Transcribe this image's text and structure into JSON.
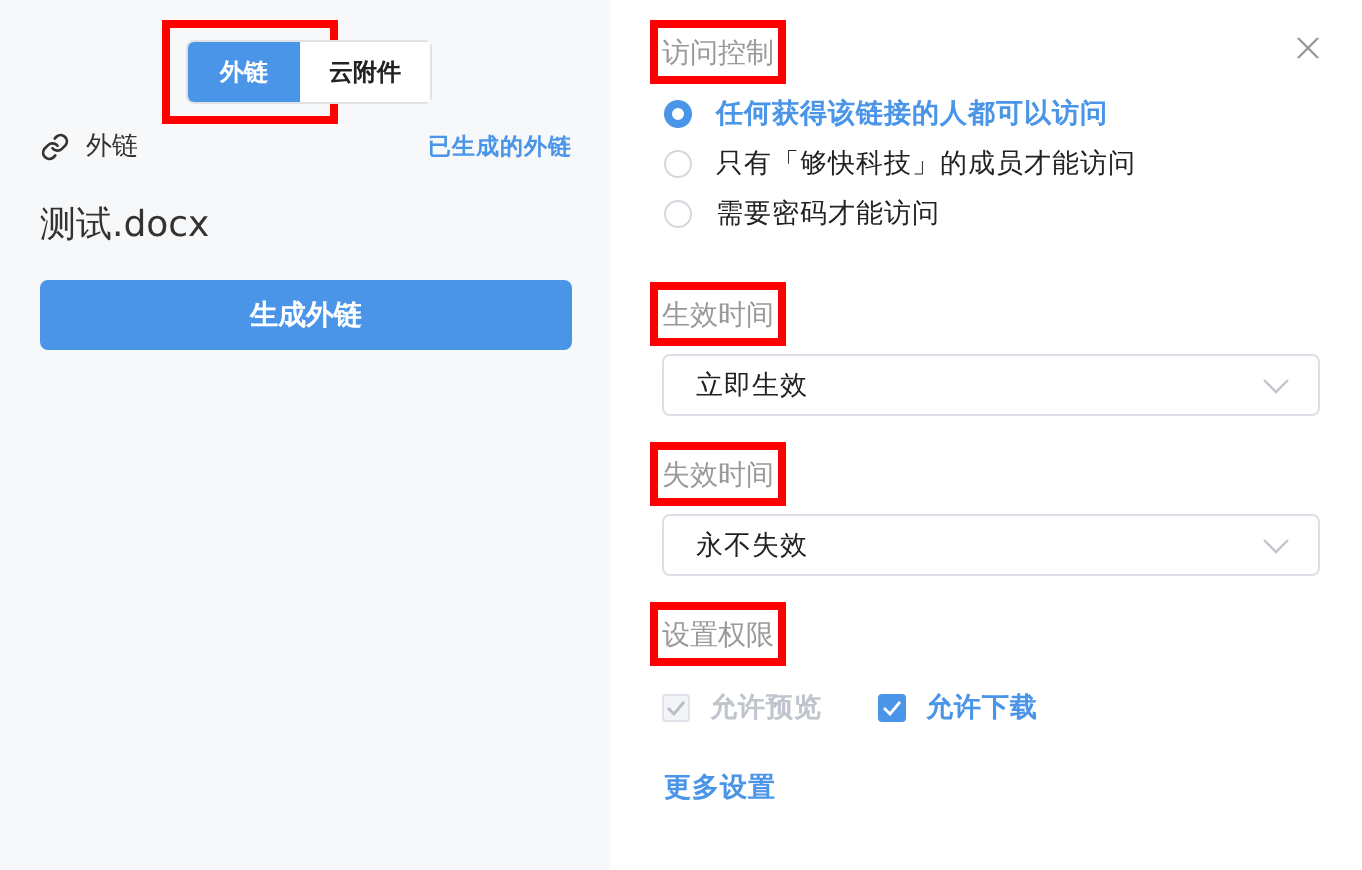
{
  "left": {
    "toggle": {
      "highlighted": true,
      "options": [
        {
          "label": "外链",
          "selected": true
        },
        {
          "label": "云附件",
          "selected": false
        }
      ]
    },
    "link_label": "外链",
    "generated_link": "已生成的外链",
    "file_name": "测试.docx",
    "generate_button": "生成外链"
  },
  "right": {
    "access": {
      "title": "访问控制",
      "highlighted": true,
      "options": [
        {
          "label": "任何获得该链接的人都可以访问",
          "selected": true
        },
        {
          "label": "只有「够快科技」的成员才能访问",
          "selected": false
        },
        {
          "label": "需要密码才能访问",
          "selected": false
        }
      ]
    },
    "start": {
      "title": "生效时间",
      "highlighted": true,
      "value": "立即生效"
    },
    "end": {
      "title": "失效时间",
      "highlighted": true,
      "value": "永不失效"
    },
    "permissions": {
      "title": "设置权限",
      "highlighted": true,
      "options": [
        {
          "label": "允许预览",
          "checked": true,
          "disabled": true
        },
        {
          "label": "允许下载",
          "checked": true,
          "disabled": false
        }
      ]
    },
    "more_link": "更多设置"
  }
}
